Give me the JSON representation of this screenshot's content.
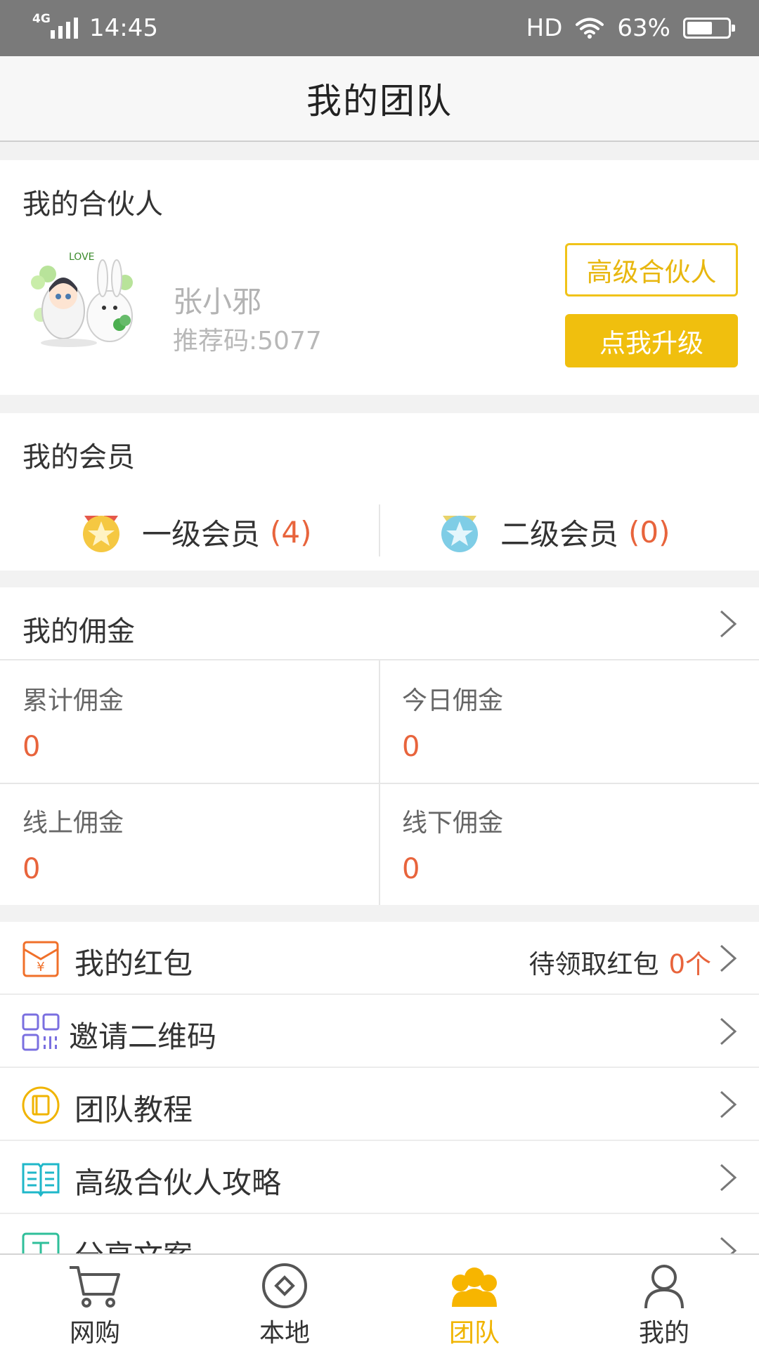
{
  "status_bar": {
    "network": "4G",
    "time": "14:45",
    "hd": "HD",
    "battery": "63%",
    "battery_level": 0.63
  },
  "header": {
    "title": "我的团队"
  },
  "partner": {
    "section_title": "我的合伙人",
    "name": "张小邪",
    "referral_code": "推荐码:5077",
    "level_button": "高级合伙人",
    "upgrade_button": "点我升级"
  },
  "members": {
    "section_title": "我的会员",
    "items": [
      {
        "label": "一级会员",
        "count": "(4)"
      },
      {
        "label": "二级会员",
        "count": "(0)"
      }
    ]
  },
  "commission": {
    "section_title": "我的佣金",
    "cells": [
      {
        "label": "累计佣金",
        "value": "0"
      },
      {
        "label": "今日佣金",
        "value": "0"
      },
      {
        "label": "线上佣金",
        "value": "0"
      },
      {
        "label": "线下佣金",
        "value": "0"
      }
    ]
  },
  "menu": {
    "items": [
      {
        "label": "我的红包",
        "extra_label": "待领取红包",
        "extra_value": "0个",
        "icon": "red-envelope-icon"
      },
      {
        "label": "邀请二维码",
        "icon": "qr-code-icon"
      },
      {
        "label": "团队教程",
        "icon": "book-icon"
      },
      {
        "label": "高级合伙人攻略",
        "icon": "open-book-icon"
      },
      {
        "label": "分享文案",
        "icon": "share-text-icon"
      }
    ]
  },
  "tabbar": {
    "tabs": [
      {
        "label": "网购",
        "icon": "cart-icon"
      },
      {
        "label": "本地",
        "icon": "location-diamond-icon"
      },
      {
        "label": "团队",
        "icon": "team-icon",
        "active": true
      },
      {
        "label": "我的",
        "icon": "person-icon"
      }
    ]
  },
  "colors": {
    "accent": "#f0bf0e",
    "highlight": "#e8643c",
    "status_bar": "#7a7a7a"
  }
}
